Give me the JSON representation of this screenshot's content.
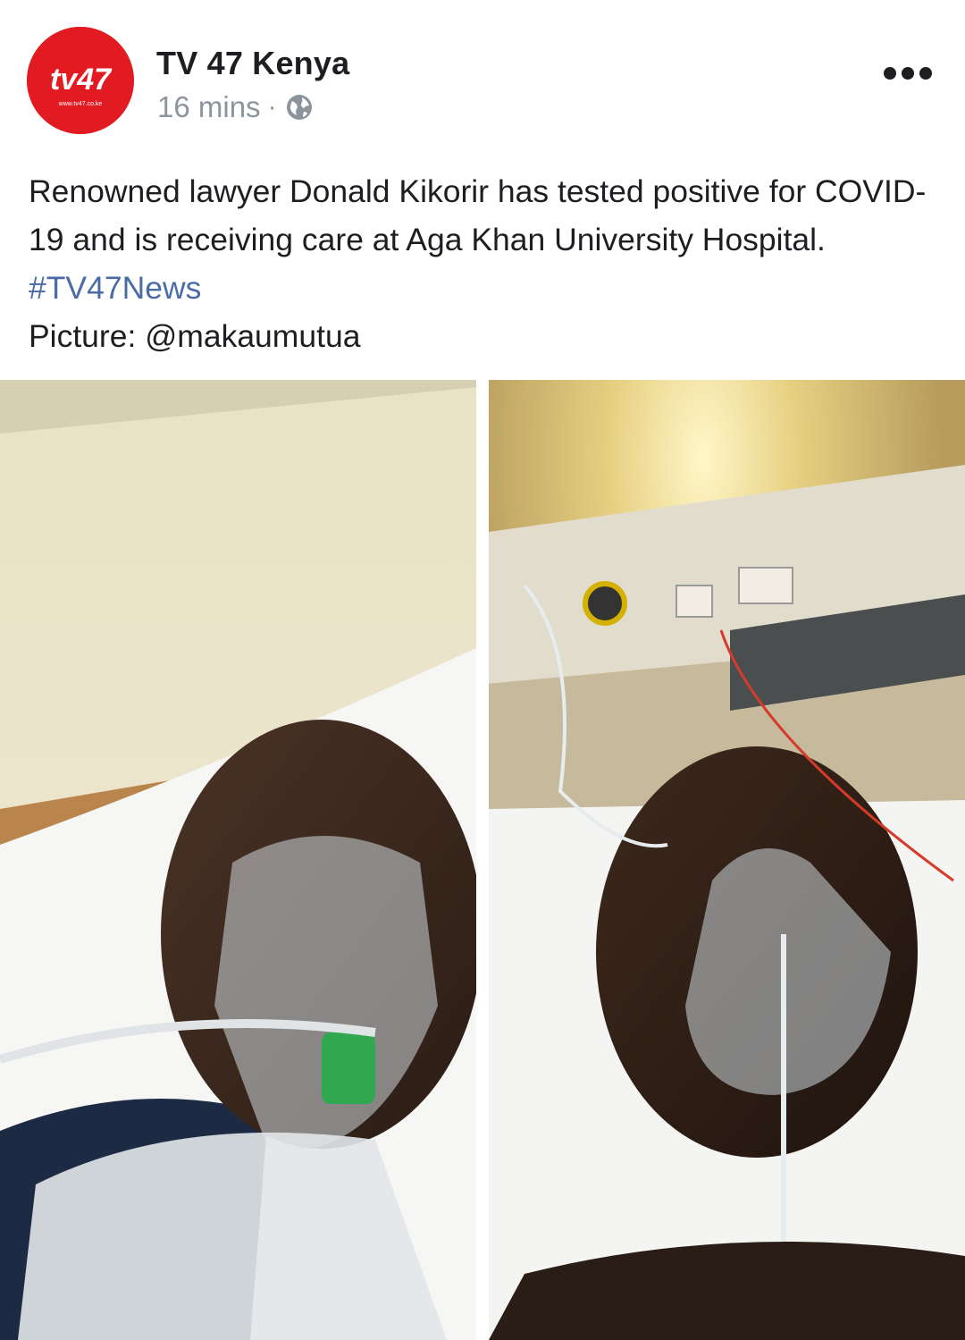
{
  "post": {
    "author": "TV 47 Kenya",
    "timestamp": "16 mins",
    "separator": "·",
    "privacy_icon": "globe-icon",
    "more_icon": "more-horizontal-icon",
    "text": {
      "body": "Renowned lawyer Donald Kikorir has tested positive for COVID-19 and is receiving care at Aga Khan University Hospital.",
      "hashtag": "#TV47News",
      "credit": "Picture: @makaumutua"
    },
    "avatar": {
      "logo_text": "tv47",
      "url_text": "www.tv47.co.ke",
      "color": "#e21b22"
    },
    "photos": [
      {
        "name": "photo-left",
        "description_icon": "hospital-photo"
      },
      {
        "name": "photo-right",
        "description_icon": "hospital-photo"
      }
    ]
  },
  "colors": {
    "hashtag": "#4a6ba5",
    "meta": "#8d949e",
    "brand": "#e21b22"
  }
}
